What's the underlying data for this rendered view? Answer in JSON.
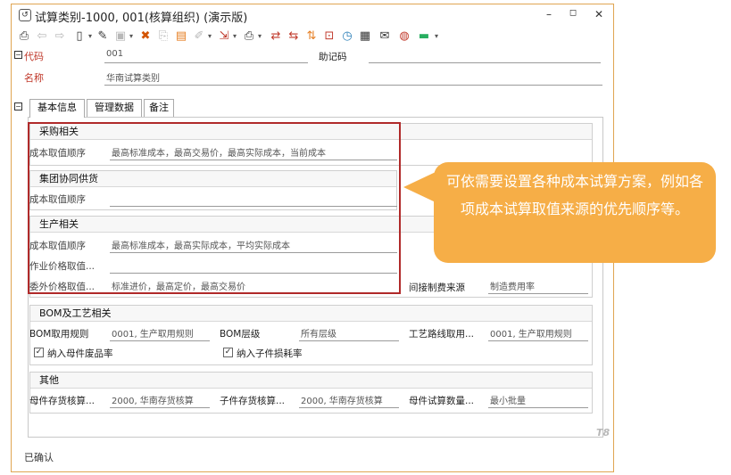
{
  "window": {
    "title": "试算类别-1000, 001(核算组织) (演示版)",
    "icon_label": "↺",
    "controls": {
      "minimize": "–",
      "maximize": "◻",
      "close": "✕"
    }
  },
  "toolbar": {
    "icons": [
      "preview-icon",
      "back-icon",
      "forward-icon",
      "new-icon",
      "edit-icon",
      "save-icon",
      "delete-icon",
      "copy-icon",
      "paste-icon",
      "attach-icon",
      "print-icon",
      "link-icon",
      "transfer-icon",
      "switch-icon",
      "lock-icon",
      "calc-icon",
      "grid-icon",
      "mail-icon",
      "chat-icon",
      "note-icon"
    ]
  },
  "header": {
    "code_label": "代码",
    "code_value": "001",
    "mnemonic_label": "助记码",
    "name_label": "名称",
    "name_value": "华南试算类别",
    "collapse_symbol": "−"
  },
  "tabs": [
    {
      "label": "基本信息"
    },
    {
      "label": "管理数据"
    },
    {
      "label": "备注"
    }
  ],
  "tabs_collapse_symbol": "−",
  "purchase": {
    "title": "采购相关",
    "cost_order_label": "成本取值顺序",
    "cost_order_value": "最高标准成本，最高交易价，最高实际成本，当前成本"
  },
  "group_supply": {
    "title": "集团协同供货",
    "cost_order_label": "成本取值顺序",
    "cost_order_value": ""
  },
  "production": {
    "title": "生产相关",
    "cost_order_label": "成本取值顺序",
    "cost_order_value": "最高标准成本，最高实际成本，平均实际成本",
    "work_price_label": "作业价格取值...",
    "work_price_value": "",
    "outsource_label": "委外价格取值...",
    "outsource_value": "标准进价，最高定价，最高交易价",
    "indirect_label": "间接制费来源",
    "indirect_value": "制造费用率"
  },
  "bom": {
    "title": "BOM及工艺相关",
    "rule_label": "BOM取用规则",
    "rule_value": "0001, 生产取用规则",
    "level_label": "BOM层级",
    "level_value": "所有层级",
    "route_label": "工艺路线取用...",
    "route_value": "0001, 生产取用规则",
    "check1_label": "纳入母件废品率",
    "check2_label": "纳入子件损耗率",
    "check_mark": "✓"
  },
  "other": {
    "title": "其他",
    "parent_label": "母件存货核算...",
    "parent_value": "2000, 华南存货核算",
    "child_label": "子件存货核算...",
    "child_value": "2000, 华南存货核算",
    "qty_label": "母件试算数量...",
    "qty_value": "最小批量"
  },
  "brand_mark": "T8",
  "status_text": "已确认",
  "callout": {
    "text": "可依需要设置各种成本试算方案，例如各项成本试算取值来源的优先顺序等。"
  },
  "colors": {
    "callout": "#f6ae47",
    "highlight_border": "#b02a2a",
    "required_label": "#c0392b",
    "window_border": "#e0a552"
  }
}
